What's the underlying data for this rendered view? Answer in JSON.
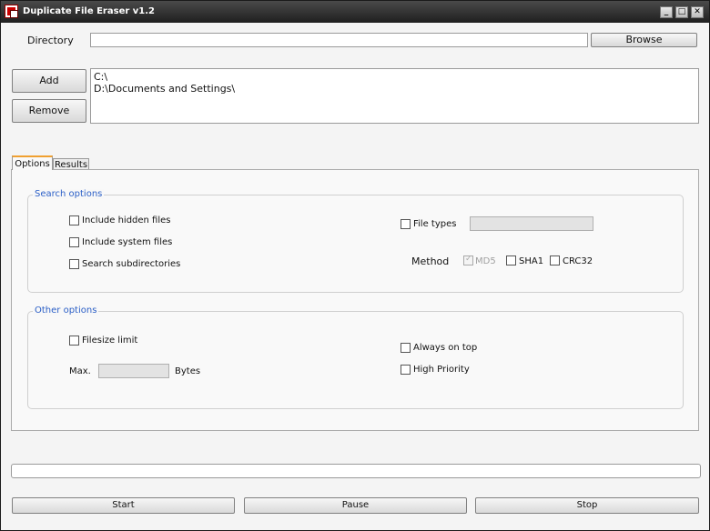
{
  "window": {
    "title": "Duplicate File Eraser v1.2"
  },
  "titlebar": {
    "minimize": "_",
    "maximize": "□",
    "close": "✕"
  },
  "directory": {
    "label": "Directory",
    "value": "",
    "browse_label": "Browse"
  },
  "list": {
    "add_label": "Add",
    "remove_label": "Remove",
    "items": [
      "C:\\",
      "D:\\Documents and Settings\\"
    ]
  },
  "tabs": [
    {
      "label": "Options",
      "active": true
    },
    {
      "label": "Results",
      "active": false
    }
  ],
  "search_options": {
    "title": "Search options",
    "include_hidden": {
      "label": "Include hidden files",
      "checked": false
    },
    "include_system": {
      "label": "Include system files",
      "checked": false
    },
    "search_subdirs": {
      "label": "Search subdirectories",
      "checked": false
    },
    "file_types": {
      "label": "File types",
      "checked": false,
      "value": ""
    },
    "method": {
      "label": "Method",
      "md5": {
        "label": "MD5",
        "checked": true,
        "disabled": true
      },
      "sha1": {
        "label": "SHA1",
        "checked": false
      },
      "crc32": {
        "label": "CRC32",
        "checked": false
      }
    }
  },
  "other_options": {
    "title": "Other options",
    "filesize_limit": {
      "label": "Filesize limit",
      "checked": false
    },
    "max_label": "Max.",
    "max_value": "",
    "bytes_label": "Bytes",
    "always_on_top": {
      "label": "Always on top",
      "checked": false
    },
    "high_priority": {
      "label": "High Priority",
      "checked": false
    }
  },
  "progress": {
    "value": 0
  },
  "actions": {
    "start": "Start",
    "pause": "Pause",
    "stop": "Stop"
  }
}
